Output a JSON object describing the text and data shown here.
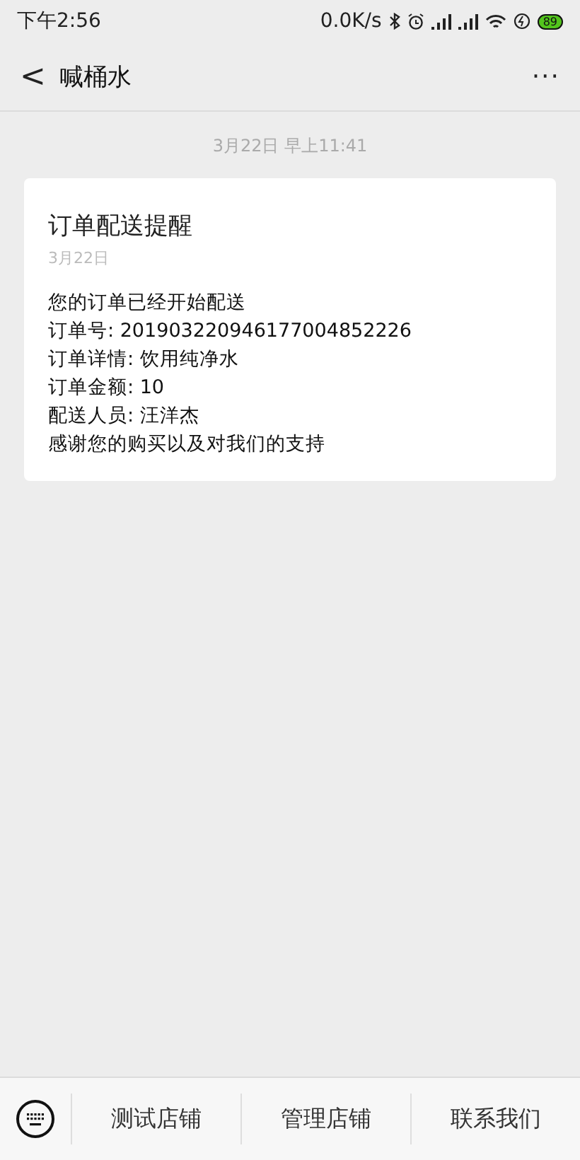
{
  "status_bar": {
    "time": "下午2:56",
    "speed": "0.0K/s",
    "battery": "89"
  },
  "nav": {
    "back": "<",
    "title": "喊桶水",
    "more": "···"
  },
  "timestamp": "3月22日 早上11:41",
  "card": {
    "title": "订单配送提醒",
    "date": "3月22日",
    "lines": [
      "您的订单已经开始配送",
      "订单号: 201903220946177004852226",
      "订单详情: 饮用纯净水",
      "订单金额: 10",
      "配送人员: 汪洋杰",
      "感谢您的购买以及对我们的支持"
    ]
  },
  "menu": [
    "测试店铺",
    "管理店铺",
    "联系我们"
  ]
}
